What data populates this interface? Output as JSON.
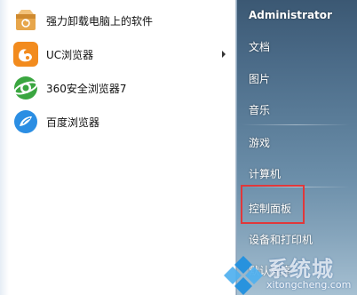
{
  "programs": [
    {
      "label": "强力卸载电脑上的软件",
      "icon": "uninstaller-box-icon",
      "has_submenu": false
    },
    {
      "label": "UC浏览器",
      "icon": "uc-browser-icon",
      "has_submenu": true
    },
    {
      "label": "360安全浏览器7",
      "icon": "360-browser-icon",
      "has_submenu": false
    },
    {
      "label": "百度浏览器",
      "icon": "baidu-browser-icon",
      "has_submenu": false
    }
  ],
  "places": {
    "user": "Administrator",
    "documents": "文档",
    "pictures": "图片",
    "music": "音乐",
    "games": "游戏",
    "computer": "计算机",
    "control_panel": "控制面板",
    "devices_printers": "设备和打印机",
    "partial_item": "默认程序"
  },
  "highlight": {
    "target": "控制面板",
    "color": "#e0383b"
  },
  "watermark": {
    "main": "系统城",
    "site": "xitongcheng.com"
  },
  "colors": {
    "right_pane_top": "#3b5873",
    "right_pane_bottom": "#a6c0d2",
    "highlight_border": "#e0383b"
  }
}
